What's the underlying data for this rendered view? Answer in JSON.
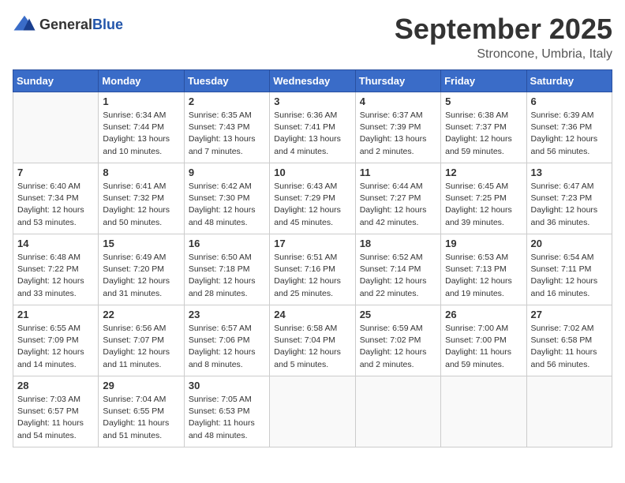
{
  "logo": {
    "general": "General",
    "blue": "Blue"
  },
  "header": {
    "title": "September 2025",
    "subtitle": "Stroncone, Umbria, Italy"
  },
  "weekdays": [
    "Sunday",
    "Monday",
    "Tuesday",
    "Wednesday",
    "Thursday",
    "Friday",
    "Saturday"
  ],
  "weeks": [
    [
      {
        "day": "",
        "info": ""
      },
      {
        "day": "1",
        "info": "Sunrise: 6:34 AM\nSunset: 7:44 PM\nDaylight: 13 hours\nand 10 minutes."
      },
      {
        "day": "2",
        "info": "Sunrise: 6:35 AM\nSunset: 7:43 PM\nDaylight: 13 hours\nand 7 minutes."
      },
      {
        "day": "3",
        "info": "Sunrise: 6:36 AM\nSunset: 7:41 PM\nDaylight: 13 hours\nand 4 minutes."
      },
      {
        "day": "4",
        "info": "Sunrise: 6:37 AM\nSunset: 7:39 PM\nDaylight: 13 hours\nand 2 minutes."
      },
      {
        "day": "5",
        "info": "Sunrise: 6:38 AM\nSunset: 7:37 PM\nDaylight: 12 hours\nand 59 minutes."
      },
      {
        "day": "6",
        "info": "Sunrise: 6:39 AM\nSunset: 7:36 PM\nDaylight: 12 hours\nand 56 minutes."
      }
    ],
    [
      {
        "day": "7",
        "info": "Sunrise: 6:40 AM\nSunset: 7:34 PM\nDaylight: 12 hours\nand 53 minutes."
      },
      {
        "day": "8",
        "info": "Sunrise: 6:41 AM\nSunset: 7:32 PM\nDaylight: 12 hours\nand 50 minutes."
      },
      {
        "day": "9",
        "info": "Sunrise: 6:42 AM\nSunset: 7:30 PM\nDaylight: 12 hours\nand 48 minutes."
      },
      {
        "day": "10",
        "info": "Sunrise: 6:43 AM\nSunset: 7:29 PM\nDaylight: 12 hours\nand 45 minutes."
      },
      {
        "day": "11",
        "info": "Sunrise: 6:44 AM\nSunset: 7:27 PM\nDaylight: 12 hours\nand 42 minutes."
      },
      {
        "day": "12",
        "info": "Sunrise: 6:45 AM\nSunset: 7:25 PM\nDaylight: 12 hours\nand 39 minutes."
      },
      {
        "day": "13",
        "info": "Sunrise: 6:47 AM\nSunset: 7:23 PM\nDaylight: 12 hours\nand 36 minutes."
      }
    ],
    [
      {
        "day": "14",
        "info": "Sunrise: 6:48 AM\nSunset: 7:22 PM\nDaylight: 12 hours\nand 33 minutes."
      },
      {
        "day": "15",
        "info": "Sunrise: 6:49 AM\nSunset: 7:20 PM\nDaylight: 12 hours\nand 31 minutes."
      },
      {
        "day": "16",
        "info": "Sunrise: 6:50 AM\nSunset: 7:18 PM\nDaylight: 12 hours\nand 28 minutes."
      },
      {
        "day": "17",
        "info": "Sunrise: 6:51 AM\nSunset: 7:16 PM\nDaylight: 12 hours\nand 25 minutes."
      },
      {
        "day": "18",
        "info": "Sunrise: 6:52 AM\nSunset: 7:14 PM\nDaylight: 12 hours\nand 22 minutes."
      },
      {
        "day": "19",
        "info": "Sunrise: 6:53 AM\nSunset: 7:13 PM\nDaylight: 12 hours\nand 19 minutes."
      },
      {
        "day": "20",
        "info": "Sunrise: 6:54 AM\nSunset: 7:11 PM\nDaylight: 12 hours\nand 16 minutes."
      }
    ],
    [
      {
        "day": "21",
        "info": "Sunrise: 6:55 AM\nSunset: 7:09 PM\nDaylight: 12 hours\nand 14 minutes."
      },
      {
        "day": "22",
        "info": "Sunrise: 6:56 AM\nSunset: 7:07 PM\nDaylight: 12 hours\nand 11 minutes."
      },
      {
        "day": "23",
        "info": "Sunrise: 6:57 AM\nSunset: 7:06 PM\nDaylight: 12 hours\nand 8 minutes."
      },
      {
        "day": "24",
        "info": "Sunrise: 6:58 AM\nSunset: 7:04 PM\nDaylight: 12 hours\nand 5 minutes."
      },
      {
        "day": "25",
        "info": "Sunrise: 6:59 AM\nSunset: 7:02 PM\nDaylight: 12 hours\nand 2 minutes."
      },
      {
        "day": "26",
        "info": "Sunrise: 7:00 AM\nSunset: 7:00 PM\nDaylight: 11 hours\nand 59 minutes."
      },
      {
        "day": "27",
        "info": "Sunrise: 7:02 AM\nSunset: 6:58 PM\nDaylight: 11 hours\nand 56 minutes."
      }
    ],
    [
      {
        "day": "28",
        "info": "Sunrise: 7:03 AM\nSunset: 6:57 PM\nDaylight: 11 hours\nand 54 minutes."
      },
      {
        "day": "29",
        "info": "Sunrise: 7:04 AM\nSunset: 6:55 PM\nDaylight: 11 hours\nand 51 minutes."
      },
      {
        "day": "30",
        "info": "Sunrise: 7:05 AM\nSunset: 6:53 PM\nDaylight: 11 hours\nand 48 minutes."
      },
      {
        "day": "",
        "info": ""
      },
      {
        "day": "",
        "info": ""
      },
      {
        "day": "",
        "info": ""
      },
      {
        "day": "",
        "info": ""
      }
    ]
  ]
}
